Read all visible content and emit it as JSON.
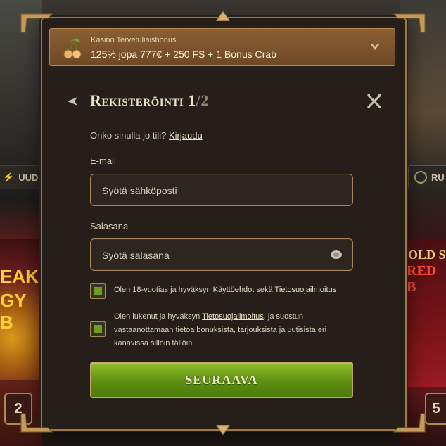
{
  "background": {
    "left_tab_label": "UUD",
    "right_tab_label": "RU",
    "left_badge": "2",
    "right_badge": "5",
    "left_game_text_1": "EAK",
    "left_game_text_2": "GY B",
    "right_game_text_1": "OLD S",
    "right_game_text_2": "RED B"
  },
  "bonus": {
    "label": "Kasino Tervetuliaisbonus",
    "value": "125% jopa 777€ + 250 FS + 1 Bonus Crab",
    "icon": "cherry-icon",
    "chevron_icon": "chevron-down-icon"
  },
  "header": {
    "title_main": "Rekisteröinti 1",
    "title_step": "/2",
    "back_icon": "arrow-left-icon",
    "close_icon": "close-icon"
  },
  "login": {
    "prompt": "Onko sinulla jo tili? ",
    "link": "Kirjaudu"
  },
  "email": {
    "label": "E-mail",
    "placeholder": "Syötä sähköposti",
    "value": ""
  },
  "password": {
    "label": "Salasana",
    "placeholder": "Syötä salasana",
    "value": "",
    "toggle_icon": "eye-icon"
  },
  "consent1": {
    "text_before": "Olen 18-vuotias ja hyväksyn ",
    "link1": "Käyttöehdot",
    "text_mid": " sekä ",
    "link2": "Tietosuojailmoitus",
    "checked": true
  },
  "consent2": {
    "text_before": "Olen lukenut ja hyväksyn ",
    "link": "Tietosuojailmoitus",
    "text_after": ", ja suostun vastaanottamaan tietoa bonuksista, tarjouksista ja uutisista eri kanavissa silloin tällöin.",
    "checked": true
  },
  "next_button": {
    "label": "SEURAAVA"
  },
  "colors": {
    "accent_gold": "#9c7a45",
    "button_green": "#6aa01e",
    "modal_bg": "#251e19"
  }
}
